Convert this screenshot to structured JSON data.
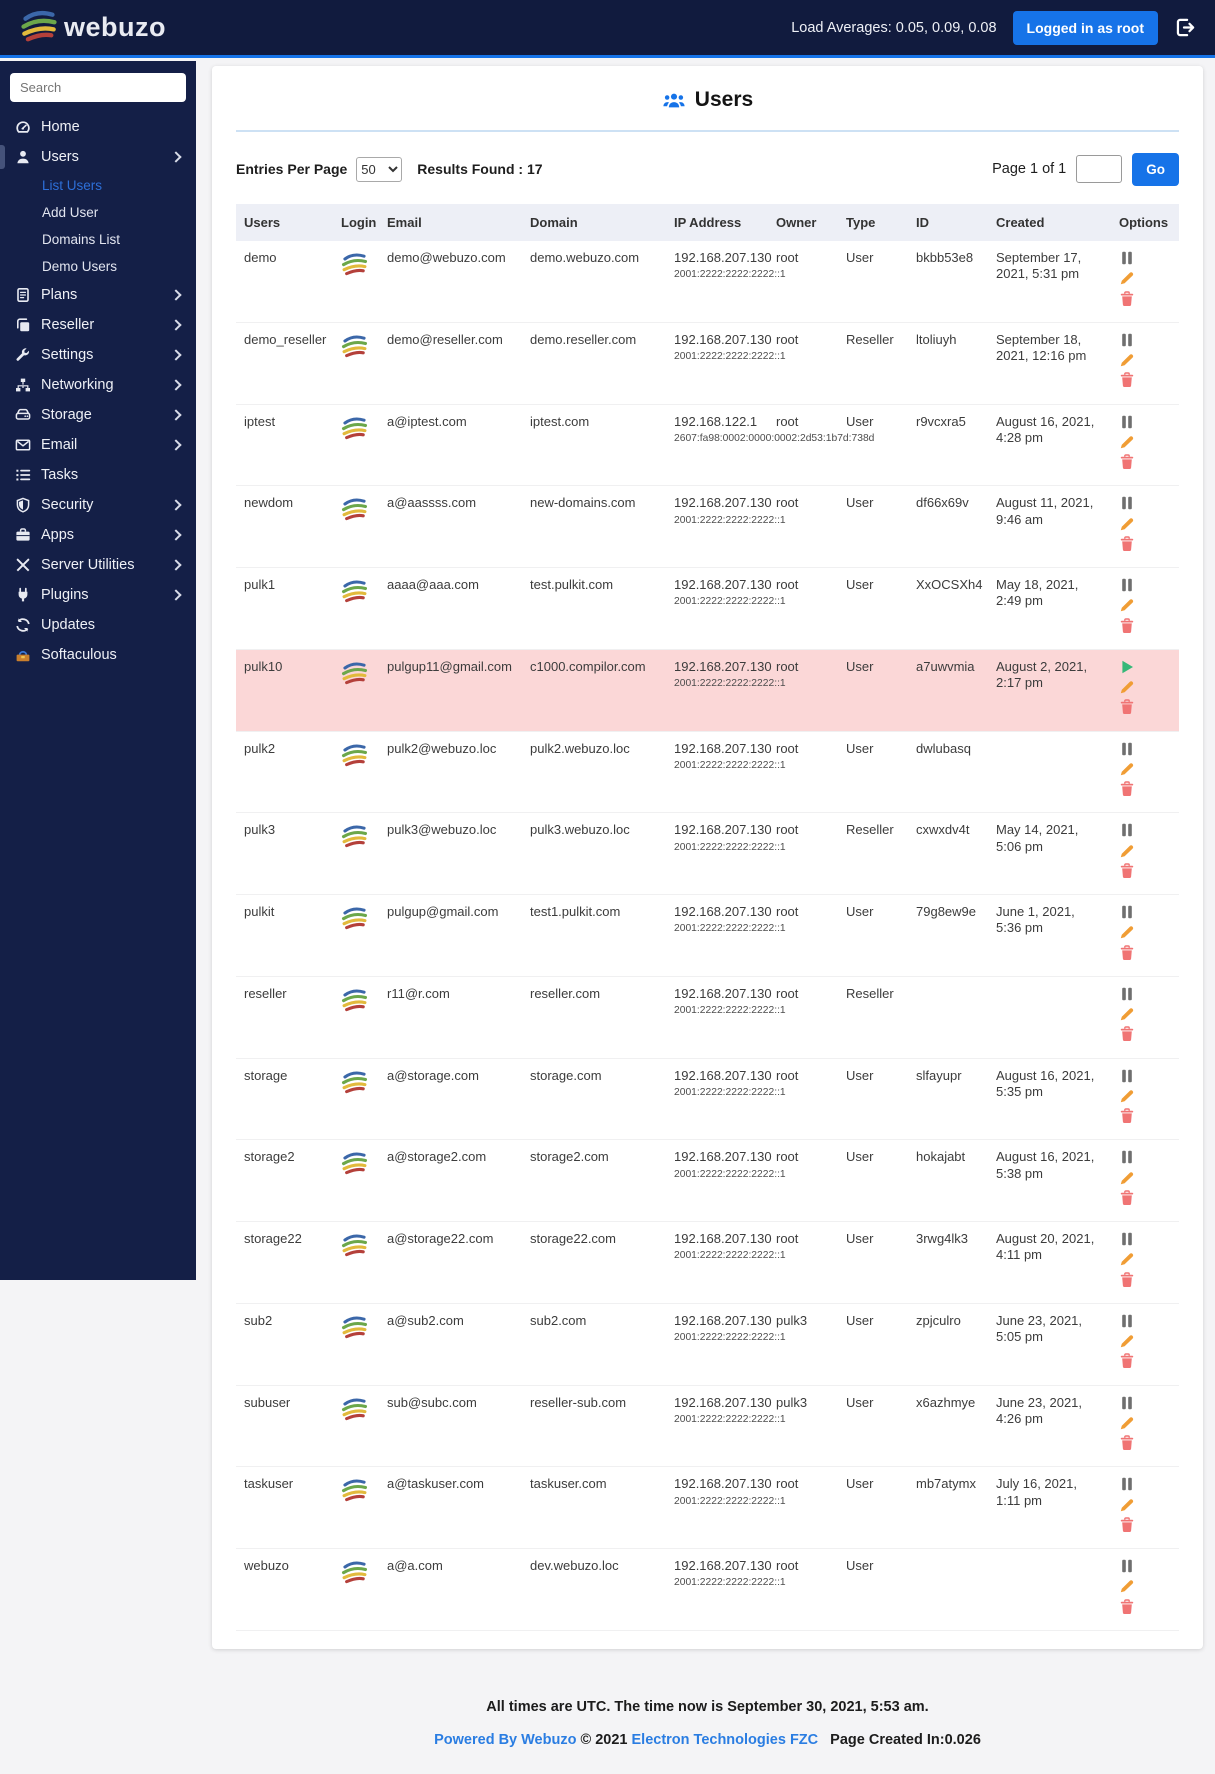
{
  "navbar": {
    "brand": "webuzo",
    "brand_icon": "webuzo-logo-icon",
    "load_averages": "Load Averages: 0.05, 0.09, 0.08",
    "login_badge": "Logged in as root",
    "logout_icon": "sign-out-icon"
  },
  "sidebar": {
    "search_placeholder": "Search",
    "items": [
      {
        "label": "Home",
        "icon": "gauge-icon",
        "expandable": false,
        "active": false
      },
      {
        "label": "Users",
        "icon": "user-icon",
        "expandable": true,
        "active": true,
        "submenu": [
          {
            "label": "List Users",
            "active": true
          },
          {
            "label": "Add User",
            "active": false
          },
          {
            "label": "Domains List",
            "active": false
          },
          {
            "label": "Demo Users",
            "active": false
          }
        ]
      },
      {
        "label": "Plans",
        "icon": "plans-icon",
        "expandable": true,
        "active": false
      },
      {
        "label": "Reseller",
        "icon": "reseller-icon",
        "expandable": true,
        "active": false
      },
      {
        "label": "Settings",
        "icon": "wrench-icon",
        "expandable": true,
        "active": false
      },
      {
        "label": "Networking",
        "icon": "sitemap-icon",
        "expandable": true,
        "active": false
      },
      {
        "label": "Storage",
        "icon": "hdd-icon",
        "expandable": true,
        "active": false
      },
      {
        "label": "Email",
        "icon": "envelope-icon",
        "expandable": true,
        "active": false
      },
      {
        "label": "Tasks",
        "icon": "list-icon",
        "expandable": false,
        "active": false
      },
      {
        "label": "Security",
        "icon": "shield-icon",
        "expandable": true,
        "active": false
      },
      {
        "label": "Apps",
        "icon": "briefcase-icon",
        "expandable": true,
        "active": false
      },
      {
        "label": "Server Utilities",
        "icon": "tools-icon",
        "expandable": true,
        "active": false
      },
      {
        "label": "Plugins",
        "icon": "plug-icon",
        "expandable": true,
        "active": false
      },
      {
        "label": "Updates",
        "icon": "sync-icon",
        "expandable": false,
        "active": false
      },
      {
        "label": "Softaculous",
        "icon": "softaculous-icon",
        "expandable": false,
        "active": false
      }
    ]
  },
  "main": {
    "title": "Users",
    "title_icon": "users-group-icon",
    "entries_label": "Entries Per Page",
    "entries_value": "50",
    "results_text": "Results Found : 17",
    "page_text": "Page 1 of 1",
    "page_input_value": "",
    "go_label": "Go"
  },
  "table": {
    "columns": [
      "Users",
      "Login",
      "Email",
      "Domain",
      "IP Address",
      "Owner",
      "Type",
      "ID",
      "Created",
      "Options"
    ],
    "login_icon": "webuzo-logo-icon",
    "options_icons": {
      "active": "pause-icon",
      "suspended": "play-icon",
      "edit": "pencil-icon",
      "delete": "trash-icon"
    },
    "rows": [
      {
        "user": "demo",
        "email": "demo@webuzo.com",
        "domain": "demo.webuzo.com",
        "ip": "192.168.207.130",
        "ipv6": "2001:2222:2222:2222::1",
        "owner": "root",
        "type": "User",
        "id": "bkbb53e8",
        "created": "September 17, 2021, 5:31 pm",
        "state": "active"
      },
      {
        "user": "demo_reseller",
        "email": "demo@reseller.com",
        "domain": "demo.reseller.com",
        "ip": "192.168.207.130",
        "ipv6": "2001:2222:2222:2222::1",
        "owner": "root",
        "type": "Reseller",
        "id": "ltoliuyh",
        "created": "September 18, 2021, 12:16 pm",
        "state": "active"
      },
      {
        "user": "iptest",
        "email": "a@iptest.com",
        "domain": "iptest.com",
        "ip": "192.168.122.1",
        "ipv6": "2607:fa98:0002:0000:0002:2d53:1b7d:738d",
        "owner": "root",
        "type": "User",
        "id": "r9vcxra5",
        "created": "August 16, 2021, 4:28 pm",
        "state": "active"
      },
      {
        "user": "newdom",
        "email": "a@aassss.com",
        "domain": "new-domains.com",
        "ip": "192.168.207.130",
        "ipv6": "2001:2222:2222:2222::1",
        "owner": "root",
        "type": "User",
        "id": "df66x69v",
        "created": "August 11, 2021, 9:46 am",
        "state": "active"
      },
      {
        "user": "pulk1",
        "email": "aaaa@aaa.com",
        "domain": "test.pulkit.com",
        "ip": "192.168.207.130",
        "ipv6": "2001:2222:2222:2222::1",
        "owner": "root",
        "type": "User",
        "id": "XxOCSXh4",
        "created": "May 18, 2021, 2:49 pm",
        "state": "active"
      },
      {
        "user": "pulk10",
        "email": "pulgup11@gmail.com",
        "domain": "c1000.compilor.com",
        "ip": "192.168.207.130",
        "ipv6": "2001:2222:2222:2222::1",
        "owner": "root",
        "type": "User",
        "id": "a7uwvmia",
        "created": "August 2, 2021, 2:17 pm",
        "state": "suspended"
      },
      {
        "user": "pulk2",
        "email": "pulk2@webuzo.loc",
        "domain": "pulk2.webuzo.loc",
        "ip": "192.168.207.130",
        "ipv6": "2001:2222:2222:2222::1",
        "owner": "root",
        "type": "User",
        "id": "dwlubasq",
        "created": "",
        "state": "active"
      },
      {
        "user": "pulk3",
        "email": "pulk3@webuzo.loc",
        "domain": "pulk3.webuzo.loc",
        "ip": "192.168.207.130",
        "ipv6": "2001:2222:2222:2222::1",
        "owner": "root",
        "type": "Reseller",
        "id": "cxwxdv4t",
        "created": "May 14, 2021, 5:06 pm",
        "state": "active"
      },
      {
        "user": "pulkit",
        "email": "pulgup@gmail.com",
        "domain": "test1.pulkit.com",
        "ip": "192.168.207.130",
        "ipv6": "2001:2222:2222:2222::1",
        "owner": "root",
        "type": "User",
        "id": "79g8ew9e",
        "created": "June 1, 2021, 5:36 pm",
        "state": "active"
      },
      {
        "user": "reseller",
        "email": "r11@r.com",
        "domain": "reseller.com",
        "ip": "192.168.207.130",
        "ipv6": "2001:2222:2222:2222::1",
        "owner": "root",
        "type": "Reseller",
        "id": "",
        "created": "",
        "state": "active"
      },
      {
        "user": "storage",
        "email": "a@storage.com",
        "domain": "storage.com",
        "ip": "192.168.207.130",
        "ipv6": "2001:2222:2222:2222::1",
        "owner": "root",
        "type": "User",
        "id": "slfayupr",
        "created": "August 16, 2021, 5:35 pm",
        "state": "active"
      },
      {
        "user": "storage2",
        "email": "a@storage2.com",
        "domain": "storage2.com",
        "ip": "192.168.207.130",
        "ipv6": "2001:2222:2222:2222::1",
        "owner": "root",
        "type": "User",
        "id": "hokajabt",
        "created": "August 16, 2021, 5:38 pm",
        "state": "active"
      },
      {
        "user": "storage22",
        "email": "a@storage22.com",
        "domain": "storage22.com",
        "ip": "192.168.207.130",
        "ipv6": "2001:2222:2222:2222::1",
        "owner": "root",
        "type": "User",
        "id": "3rwg4lk3",
        "created": "August 20, 2021, 4:11 pm",
        "state": "active"
      },
      {
        "user": "sub2",
        "email": "a@sub2.com",
        "domain": "sub2.com",
        "ip": "192.168.207.130",
        "ipv6": "2001:2222:2222:2222::1",
        "owner": "pulk3",
        "type": "User",
        "id": "zpjculro",
        "created": "June 23, 2021, 5:05 pm",
        "state": "active"
      },
      {
        "user": "subuser",
        "email": "sub@subc.com",
        "domain": "reseller-sub.com",
        "ip": "192.168.207.130",
        "ipv6": "2001:2222:2222:2222::1",
        "owner": "pulk3",
        "type": "User",
        "id": "x6azhmye",
        "created": "June 23, 2021, 4:26 pm",
        "state": "active"
      },
      {
        "user": "taskuser",
        "email": "a@taskuser.com",
        "domain": "taskuser.com",
        "ip": "192.168.207.130",
        "ipv6": "2001:2222:2222:2222::1",
        "owner": "root",
        "type": "User",
        "id": "mb7atymx",
        "created": "July 16, 2021, 1:11 pm",
        "state": "active"
      },
      {
        "user": "webuzo",
        "email": "a@a.com",
        "domain": "dev.webuzo.loc",
        "ip": "192.168.207.130",
        "ipv6": "2001:2222:2222:2222::1",
        "owner": "root",
        "type": "User",
        "id": "",
        "created": "",
        "state": "active"
      }
    ]
  },
  "footer": {
    "line1": "All times are UTC. The time now is September 30, 2021, 5:53 am.",
    "powered": "Powered By Webuzo",
    "copyright": "© 2021",
    "company": "Electron Technologies FZC",
    "page_created": "Page Created In:0.026"
  },
  "colors": {
    "accent": "#1673e8",
    "navbar_bg": "#111b3e",
    "sidebar_bg": "#141f47",
    "suspended_row_bg": "#fbd7d7",
    "edit_icon": "#f09d35",
    "delete_icon": "#f07474",
    "resume_icon": "#35b878",
    "pause_icon": "#6f6f6f",
    "active_submenu": "#2d6fd8"
  }
}
